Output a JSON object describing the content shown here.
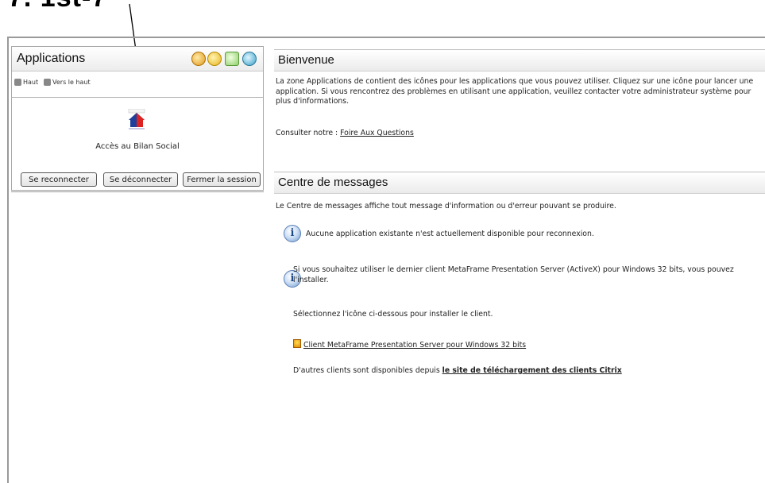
{
  "annotation": {
    "text": "7. 1st-7"
  },
  "left_panel": {
    "title": "Applications",
    "header_icons": [
      "refresh-icon",
      "key-icon",
      "preferences-icon",
      "help-icon"
    ],
    "nav": {
      "home": "Haut",
      "up": "Vers le haut"
    },
    "app": {
      "label": "Accès au Bilan Social",
      "icon": "house-icon"
    }
  },
  "buttons": {
    "reconnect": "Se reconnecter",
    "disconnect": "Se déconnecter",
    "logoff": "Fermer la session"
  },
  "welcome": {
    "title": "Bienvenue",
    "text": "La zone Applications de contient des icônes pour les applications que vous pouvez utiliser. Cliquez sur une icône pour lancer une application. Si vous rencontrez des problèmes en utilisant une application, veuillez contacter votre administrateur système pour plus d'informations.",
    "faq_prefix": "Consulter notre : ",
    "faq_link": "Foire Aux Questions"
  },
  "messages": {
    "title": "Centre de messages",
    "intro": "Le Centre de messages affiche tout message d'information ou d'erreur pouvant se produire.",
    "msg1": "Aucune application existante n'est actuellement disponible pour reconnexion.",
    "msg2": "Si vous souhaitez utiliser le dernier client MetaFrame Presentation Server (ActiveX) pour Windows 32 bits, vous pouvez l'installer.",
    "select_icon": "Sélectionnez l'icône ci-dessous pour installer le client.",
    "client_link": "Client MetaFrame Presentation Server pour Windows 32 bits",
    "others_prefix": "D'autres clients sont disponibles depuis ",
    "others_link": "le site de téléchargement des clients Citrix"
  }
}
